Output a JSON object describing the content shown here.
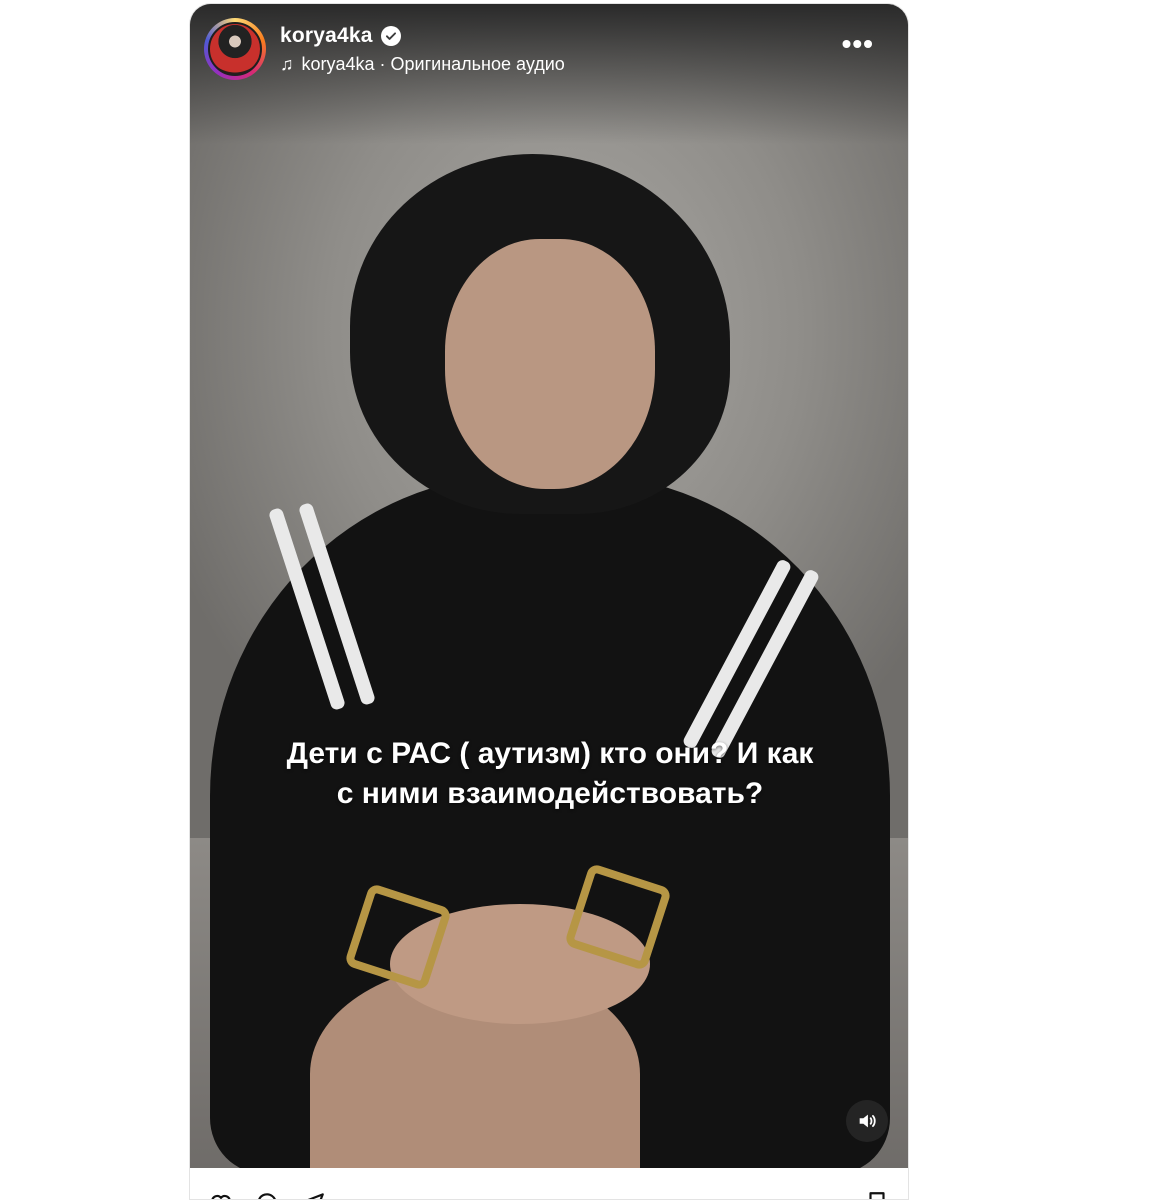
{
  "post": {
    "username": "korya4ka",
    "verified": true,
    "audio_label": "korya4ka · Оригинальное аудио",
    "caption_line1": "Дети с РАС ( аутизм) кто они? И как",
    "caption_line2": "с ними взаимодействовать?"
  },
  "icons": {
    "more": "more-options-icon",
    "music": "music-note-icon",
    "verified": "verified-badge-icon",
    "sound": "sound-on-icon",
    "like": "heart-icon",
    "comment": "comment-icon",
    "share": "share-icon",
    "save": "bookmark-icon"
  },
  "colors": {
    "caption_text": "#ffffff",
    "accent_ring": "#d62976",
    "bracelet": "#b69645"
  }
}
